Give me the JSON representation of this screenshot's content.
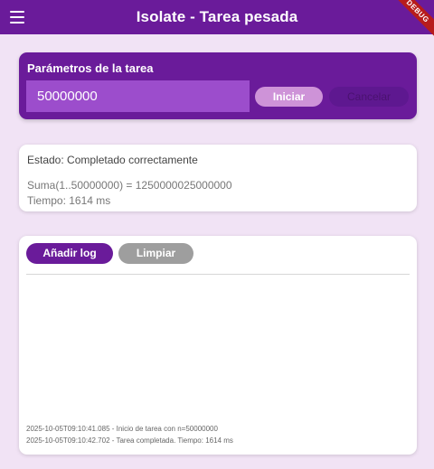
{
  "appbar": {
    "title": "Isolate - Tarea pesada",
    "menu_icon": "hamburger-menu-icon",
    "debug_label": "DEBUG",
    "color": "#6a1b9a"
  },
  "params": {
    "label": "Parámetros de la tarea",
    "input_value": "50000000",
    "start_label": "Iniciar",
    "cancel_label": "Cancelar"
  },
  "status": {
    "state": "Estado: Completado correctamente",
    "sum": "Suma(1..50000000) = 1250000025000000",
    "time": "Tiempo: 1614 ms"
  },
  "log": {
    "add_label": "Añadir log",
    "clear_label": "Limpiar",
    "lines": [
      "2025-10-05T09:10:41.085 - Inicio de tarea con n=50000000",
      "2025-10-05T09:10:42.702 - Tarea completada. Tiempo: 1614 ms"
    ]
  },
  "colors": {
    "primary": "#6a1b9a",
    "background": "#f1e3f5",
    "accent_light": "#ce93d8"
  }
}
